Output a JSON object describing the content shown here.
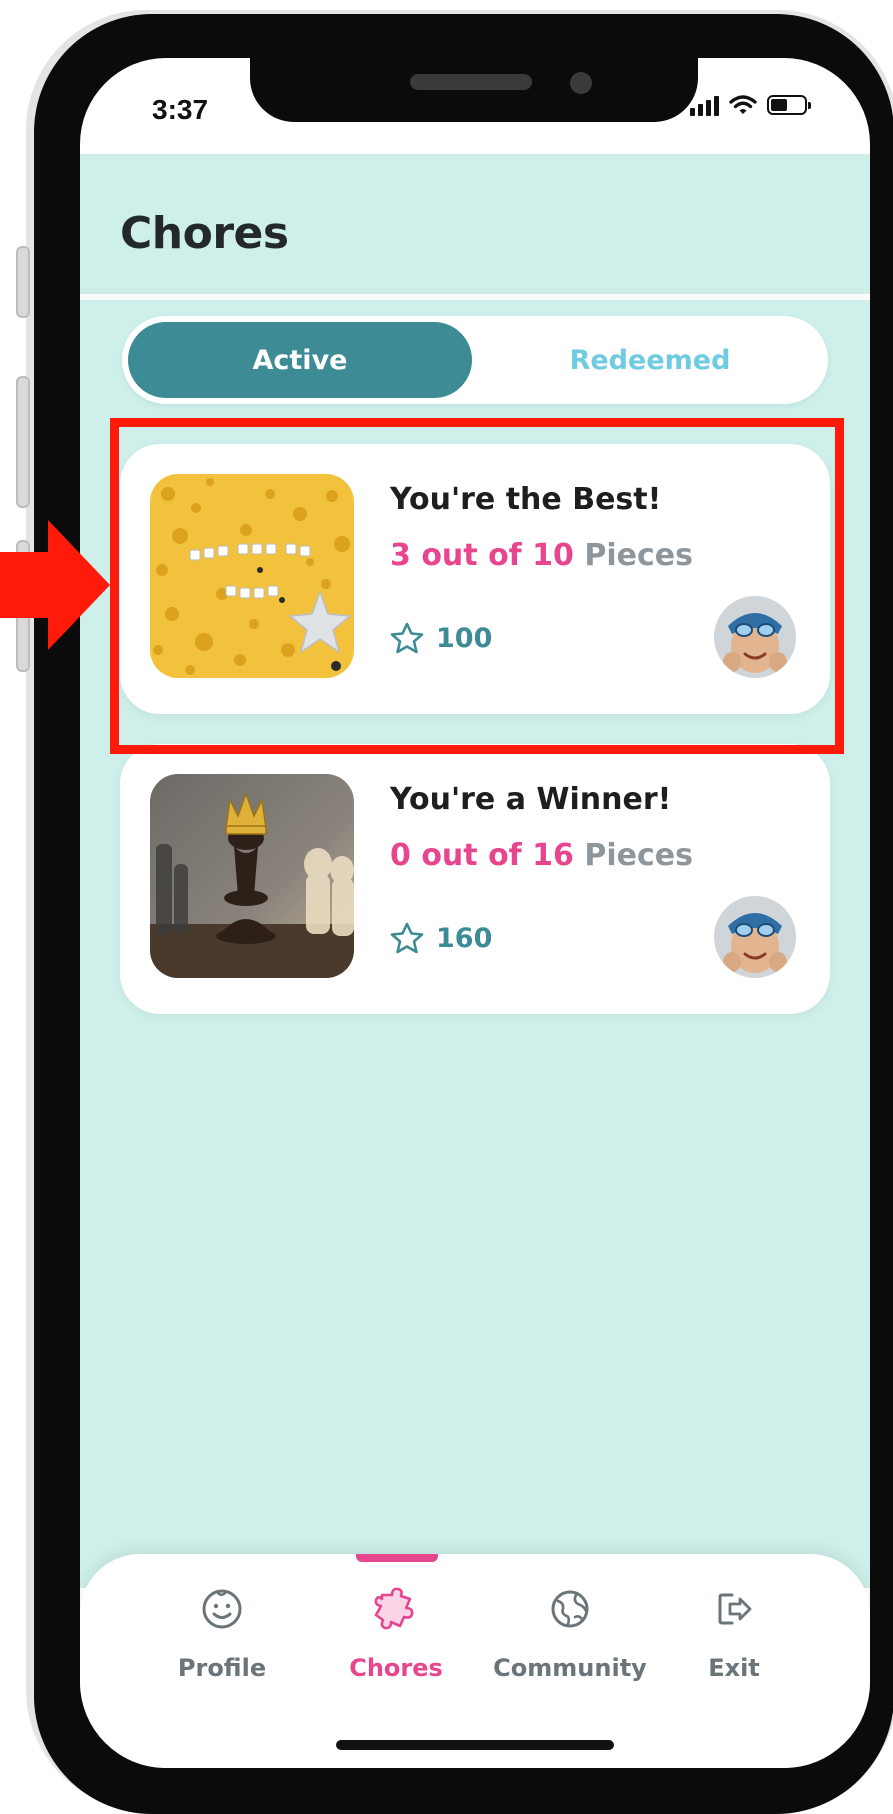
{
  "status_bar": {
    "time": "3:37"
  },
  "header": {
    "title": "Chores"
  },
  "segmented_control": {
    "active_label": "Active",
    "inactive_label": "Redeemed"
  },
  "chores": [
    {
      "title": "You're the Best!",
      "progress_count": "3 out of 10",
      "progress_unit": "Pieces",
      "points": "100",
      "thumbnail_icon": "confetti-star-image",
      "avatar_icon": "child-avatar"
    },
    {
      "title": "You're a Winner!",
      "progress_count": "0 out of 16",
      "progress_unit": "Pieces",
      "points": "160",
      "thumbnail_icon": "chess-king-image",
      "avatar_icon": "child-avatar"
    }
  ],
  "tabbar": {
    "tabs": [
      {
        "label": "Profile",
        "icon": "smiley-icon"
      },
      {
        "label": "Chores",
        "icon": "puzzle-icon"
      },
      {
        "label": "Community",
        "icon": "globe-icon"
      },
      {
        "label": "Exit",
        "icon": "logout-icon"
      }
    ],
    "active_tab": "Chores"
  },
  "colors": {
    "accent_teal": "#3d8b95",
    "accent_pink": "#e8458f",
    "background_mint": "#ceefea",
    "highlight_red": "#ff1a0a"
  }
}
